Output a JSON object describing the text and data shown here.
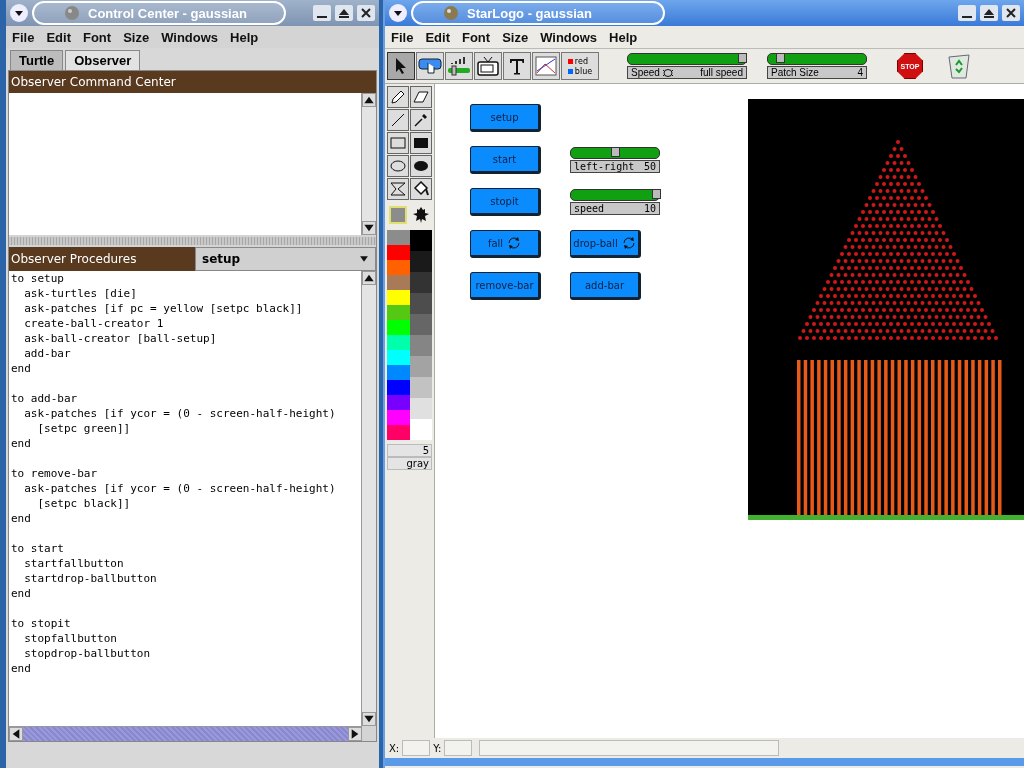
{
  "control_center": {
    "title": "Control Center - gaussian",
    "menu": [
      "File",
      "Edit",
      "Font",
      "Size",
      "Windows",
      "Help"
    ],
    "tabs": [
      {
        "label": "Turtle",
        "selected": false
      },
      {
        "label": "Observer",
        "selected": true
      }
    ],
    "command_center": {
      "title": "Observer Command Center"
    },
    "procedures": {
      "title": "Observer Procedures",
      "dropdown": "setup",
      "code": "to setup\n  ask-turtles [die]\n  ask-patches [if pc = yellow [setpc black]]\n  create-ball-creator 1\n  ask-ball-creator [ball-setup]\n  add-bar\nend\n\nto add-bar\n  ask-patches [if ycor = (0 - screen-half-height)\n    [setpc green]]\nend\n\nto remove-bar\n  ask-patches [if ycor = (0 - screen-half-height)\n    [setpc black]]\nend\n\nto start\n  startfallbutton\n  startdrop-ballbutton\nend\n\nto stopit\n  stopfallbutton\n  stopdrop-ballbutton\nend"
    }
  },
  "starlogo": {
    "title": "StarLogo - gaussian",
    "menu": [
      "File",
      "Edit",
      "Font",
      "Size",
      "Windows",
      "Help"
    ],
    "toolbar": [
      {
        "kind": "pointer",
        "selected": true
      },
      {
        "kind": "button",
        "selected": false
      },
      {
        "kind": "slider",
        "selected": false
      },
      {
        "kind": "monitor",
        "selected": false
      },
      {
        "kind": "text",
        "selected": false
      },
      {
        "kind": "graph",
        "selected": false
      },
      {
        "kind": "legend",
        "selected": false,
        "labels": [
          "red",
          "blue"
        ]
      }
    ],
    "speed_slider": {
      "label": "Speed",
      "reading": "full speed",
      "level": 0.97
    },
    "patch_size_slider": {
      "label": "Patch Size",
      "reading": "4",
      "level": 0.13
    },
    "stop_label": "STOP",
    "palette": {
      "selected_swatch": {
        "color": "#8c8c8c"
      },
      "colors_left": [
        {
          "color": "#8c8c8c"
        },
        {
          "color": "#ff0000"
        },
        {
          "color": "#ff6000"
        },
        {
          "color": "#a87a58"
        },
        {
          "color": "#ffff00"
        },
        {
          "color": "#55c814"
        },
        {
          "color": "#00ff00"
        },
        {
          "color": "#00ffaa"
        },
        {
          "color": "#00ffff"
        },
        {
          "color": "#0088ff"
        },
        {
          "color": "#0000ff"
        },
        {
          "color": "#7700ff"
        },
        {
          "color": "#ff00ff"
        },
        {
          "color": "#ff0066"
        }
      ],
      "colors_right": [
        {
          "color": "#000000"
        },
        {
          "color": "#1a1a1a"
        },
        {
          "color": "#333333"
        },
        {
          "color": "#4d4d4d"
        },
        {
          "color": "#666666"
        },
        {
          "color": "#858585"
        },
        {
          "color": "#a3a3a3"
        },
        {
          "color": "#c2c2c2"
        },
        {
          "color": "#e0e0e0"
        },
        {
          "color": "#ffffff"
        }
      ],
      "value": "5",
      "color_name": "gray"
    },
    "widget_rows": [
      [
        {
          "kind": "button",
          "label": "setup",
          "forever": false
        }
      ],
      [
        {
          "kind": "button",
          "label": "start",
          "forever": false
        },
        {
          "kind": "slider",
          "label": "left-right",
          "reading": "50",
          "level": 0.5
        }
      ],
      [
        {
          "kind": "button",
          "label": "stopit",
          "forever": false
        },
        {
          "kind": "slider",
          "label": "speed",
          "reading": "10",
          "level": 0.97
        }
      ],
      [
        {
          "kind": "button",
          "label": "fall",
          "forever": true
        },
        {
          "kind": "button",
          "label": "drop-ball",
          "forever": true
        }
      ],
      [
        {
          "kind": "button",
          "label": "remove-bar",
          "forever": false
        },
        {
          "kind": "button",
          "label": "add-bar",
          "forever": false
        }
      ]
    ],
    "status": {
      "x_label": "X:",
      "y_label": "Y:"
    }
  }
}
